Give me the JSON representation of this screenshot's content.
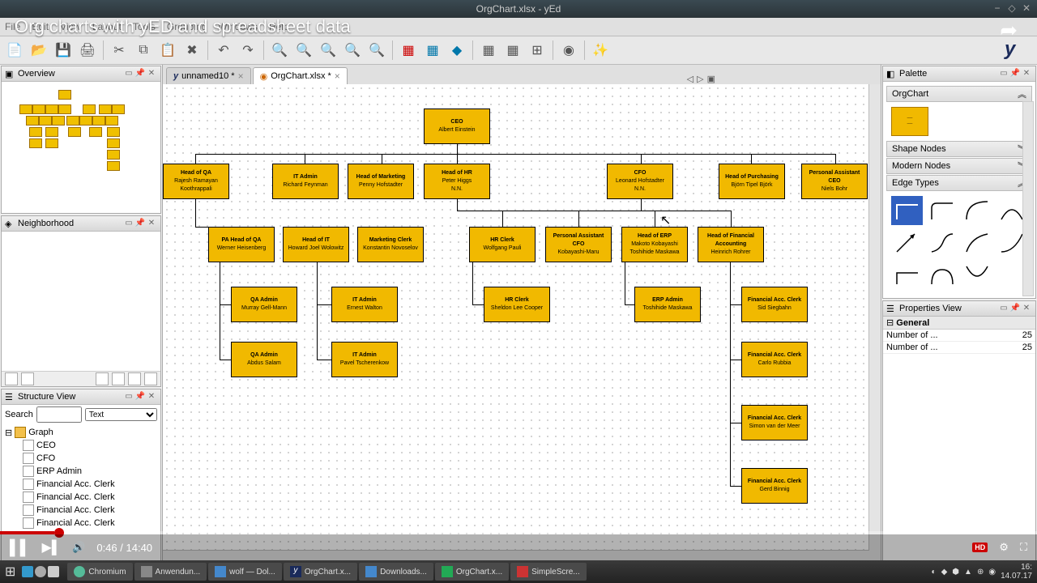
{
  "video": {
    "title": "Org charts with yED and spreadsheet data",
    "current": "0:46",
    "total": "14:40"
  },
  "window": {
    "title": "OrgChart.xlsx - yEd"
  },
  "menu": [
    "File",
    "Edit",
    "View",
    "Layout",
    "Tools",
    "Grouping",
    "Windows",
    "Help"
  ],
  "tabs": [
    {
      "label": "unnamed10 *",
      "active": false
    },
    {
      "label": "OrgChart.xlsx *",
      "active": true
    }
  ],
  "panels": {
    "overview": "Overview",
    "neighborhood": "Neighborhood",
    "structure": "Structure View",
    "palette": "Palette",
    "properties": "Properties View"
  },
  "structure": {
    "searchLabel": "Search",
    "mode": "Text",
    "root": "Graph",
    "items": [
      "CEO",
      "CFO",
      "ERP Admin",
      "Financial Acc. Clerk",
      "Financial Acc. Clerk",
      "Financial Acc. Clerk",
      "Financial Acc. Clerk"
    ]
  },
  "palette": {
    "section": "OrgChart",
    "sections": [
      "Shape Nodes",
      "Modern Nodes",
      "Edge Types"
    ]
  },
  "properties": {
    "group": "General",
    "rows": [
      {
        "k": "Number of ...",
        "v": "25"
      },
      {
        "k": "Number of ...",
        "v": "25"
      }
    ]
  },
  "org": {
    "ceo": {
      "role": "CEO",
      "name": "Albert Einstein"
    },
    "row2": [
      {
        "role": "Head of QA",
        "name": "Rajesh Ramayan Koothrappali"
      },
      {
        "role": "IT Admin",
        "name": "Richard Feynman"
      },
      {
        "role": "Head of Marketing",
        "name": "Penny Hofstadter"
      },
      {
        "role": "Head of HR",
        "name": "Peter Higgs",
        "extra": "N.N."
      },
      {
        "role": "CFO",
        "name": "Leonard Hofstadter",
        "extra": "N.N."
      },
      {
        "role": "Head of Purchasing",
        "name": "Björn Tipel Björk"
      },
      {
        "role": "Personal Assistant CEO",
        "name": "Niels Bohr"
      }
    ],
    "row3": [
      {
        "role": "PA Head of QA",
        "name": "Werner Heisenberg"
      },
      {
        "role": "Head of IT",
        "name": "Howard Joel Wolowitz"
      },
      {
        "role": "Marketing Clerk",
        "name": "Konstantin Novoselov"
      },
      {
        "role": "HR Clerk",
        "name": "Wolfgang Pauli"
      },
      {
        "role": "Personal Assistant CFO",
        "name": "Kobayashi-Maru"
      },
      {
        "role": "Head of ERP",
        "name": "Makoto Kobayashi Toshihide Maskawa"
      },
      {
        "role": "Head of Financial Accounting",
        "name": "Heinrich Rohrer"
      }
    ],
    "row4": [
      {
        "role": "QA Admin",
        "name": "Murray Gell-Mann"
      },
      {
        "role": "IT Admin",
        "name": "Ernest Walton"
      },
      {
        "role": "HR Clerk",
        "name": "Sheldon Lee Cooper"
      },
      {
        "role": "ERP Admin",
        "name": "Toshihide Maskawa"
      },
      {
        "role": "Financial Acc. Clerk",
        "name": "Sid Siegbahn"
      }
    ],
    "row5": [
      {
        "role": "QA Admin",
        "name": "Abdus Salam"
      },
      {
        "role": "IT Admin",
        "name": "Pavel Tscherenkow"
      },
      {
        "role": "Financial Acc. Clerk",
        "name": "Carlo Rubbia"
      }
    ],
    "row6": {
      "role": "Financial Acc. Clerk",
      "name": "Simon van der Meer"
    },
    "row7": {
      "role": "Financial Acc. Clerk",
      "name": "Gerd Binnig"
    }
  },
  "taskbar": {
    "items": [
      "Chromium",
      "Anwendun...",
      "wolf — Dol...",
      "OrgChart.x...",
      "Downloads...",
      "OrgChart.x...",
      "SimpleScre..."
    ],
    "time": "16:",
    "date": "14.07.17"
  }
}
